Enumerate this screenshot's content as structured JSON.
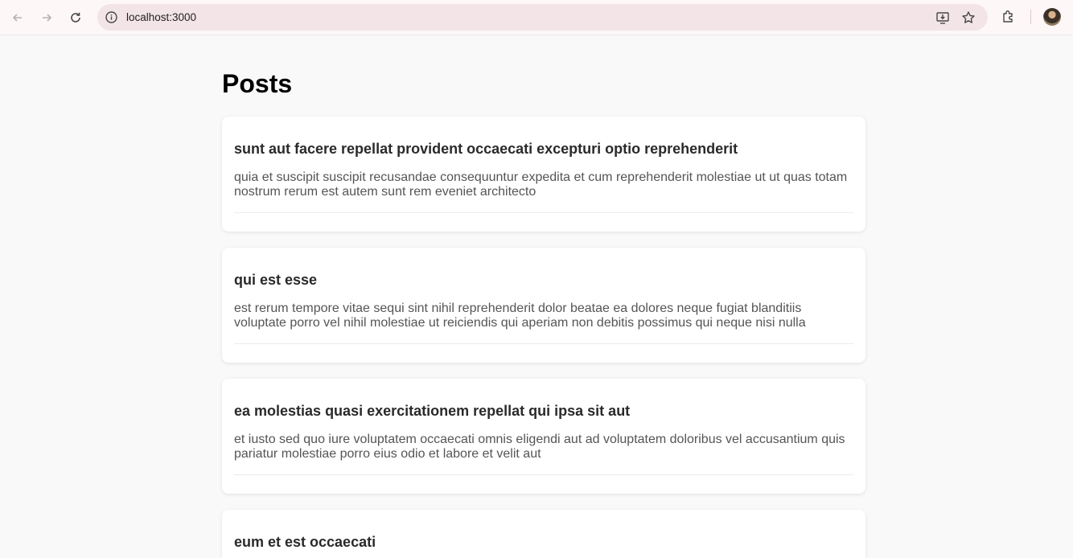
{
  "browser": {
    "url": "localhost:3000"
  },
  "page": {
    "title": "Posts"
  },
  "posts": [
    {
      "title": "sunt aut facere repellat provident occaecati excepturi optio reprehenderit",
      "body": "quia et suscipit suscipit recusandae consequuntur expedita et cum reprehenderit molestiae ut ut quas totam nostrum rerum est autem sunt rem eveniet architecto"
    },
    {
      "title": "qui est esse",
      "body": "est rerum tempore vitae sequi sint nihil reprehenderit dolor beatae ea dolores neque fugiat blanditiis voluptate porro vel nihil molestiae ut reiciendis qui aperiam non debitis possimus qui neque nisi nulla"
    },
    {
      "title": "ea molestias quasi exercitationem repellat qui ipsa sit aut",
      "body": "et iusto sed quo iure voluptatem occaecati omnis eligendi aut ad voluptatem doloribus vel accusantium quis pariatur molestiae porro eius odio et labore et velit aut"
    },
    {
      "title": "eum et est occaecati",
      "body": ""
    }
  ]
}
